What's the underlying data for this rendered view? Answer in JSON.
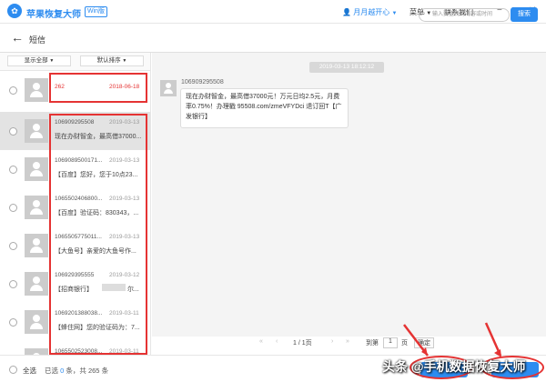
{
  "app": {
    "title": "苹果恢复大师",
    "edition": "Win版",
    "logo_icon": "app-logo-icon"
  },
  "header": {
    "user": "月月越开心",
    "user_arrow": "▼",
    "menu": "菜单",
    "menu_arrow": "▼",
    "contact": "联系我们",
    "minimize": "−",
    "maximize": "□",
    "close": "✕"
  },
  "subbar": {
    "back": "←",
    "title": "短信",
    "search_placeholder": "输入要查找的内容或时间",
    "search_button": "搜索"
  },
  "filters": {
    "show_all": "显示全部",
    "show_all_arrow": "▼",
    "sort": "默认排序",
    "sort_arrow": "▼"
  },
  "items": [
    {
      "number": "262",
      "date": "2018-06-18",
      "preview": ""
    },
    {
      "number": "106909295508",
      "date": "2019-03-13",
      "preview": "现在办财智金，最高借37000..."
    },
    {
      "number": "1069089500171...",
      "date": "2019-03-13",
      "preview": "【百度】您好，您于10点23..."
    },
    {
      "number": "1065502406800...",
      "date": "2019-03-13",
      "preview": "【百度】验证码：830343，..."
    },
    {
      "number": "1065505775011...",
      "date": "2019-03-13",
      "preview": "【大鱼号】亲爱的大鱼号作..."
    },
    {
      "number": "106929395555",
      "date": "2019-03-12",
      "preview": "【招商银行】",
      "preview_tail": "尔..."
    },
    {
      "number": "1069201388038...",
      "date": "2019-03-11",
      "preview": "【蜂住网】您的验证码为：7..."
    },
    {
      "number": "1065502523008...",
      "date": "2019-03-11",
      "preview": ""
    }
  ],
  "message": {
    "timestamp": "2019-03-13 18:12:12",
    "sender": "106909295508",
    "body": "现在办财智金，最高借37000元！万元日均2.5元，月费率0.75%！办理戳 95508.com/zmeVFYDci 退订回T【广发银行】"
  },
  "pager": {
    "first": "«",
    "prev": "‹",
    "page": "1 / 1页",
    "next": "›",
    "last": "»",
    "goto_label": "到第",
    "goto_value": "1",
    "goto_unit": "页",
    "confirm": "确定"
  },
  "footer": {
    "select_all": "全选",
    "selected_prefix": "已选",
    "selected_count": "0",
    "selected_mid": "条，共",
    "total": "265",
    "selected_suffix": "条"
  },
  "watermark": {
    "logo": "头",
    "text": "头条 @手机数据恢复大师"
  }
}
